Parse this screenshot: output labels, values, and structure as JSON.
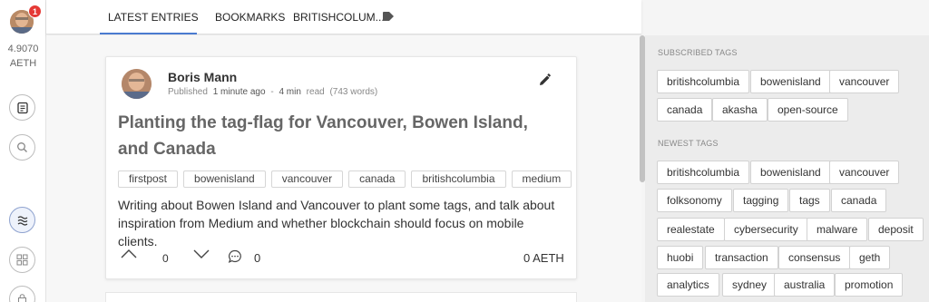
{
  "rail": {
    "notification_count": "1",
    "balance_value": "4.9070",
    "balance_unit": "AETH",
    "icons": [
      "drafts-icon",
      "search-icon",
      "stream-icon",
      "apps-icon",
      "lock-icon"
    ]
  },
  "tabs": {
    "latest": "LATEST ENTRIES",
    "bookmarks": "BOOKMARKS",
    "tag": "BRITISHCOLUM..."
  },
  "entry": {
    "author": "Boris Mann",
    "published_label": "Published",
    "published_time": "1 minute ago",
    "separator": "-",
    "read_time": "4 min",
    "read_label": "read",
    "word_count": "(743 words)",
    "title": "Planting the tag-flag for Vancouver, Bowen Island, and Canada",
    "tags": [
      "firstpost",
      "bowenisland",
      "vancouver",
      "canada",
      "britishcolumbia",
      "medium"
    ],
    "excerpt": "Writing about Bowen Island and Vancouver to plant some tags, and talk about inspiration from Medium and whether blockchain should focus on mobile clients.",
    "score": "0",
    "comments": "0",
    "balance": "0 AETH"
  },
  "sidebar": {
    "subscribed_title": "SUBSCRIBED TAGS",
    "subscribed": [
      "britishcolumbia",
      "bowenisland",
      "vancouver",
      "canada",
      "akasha",
      "open-source"
    ],
    "newest_title": "NEWEST TAGS",
    "newest": [
      "britishcolumbia",
      "bowenisland",
      "vancouver",
      "folksonomy",
      "tagging",
      "tags",
      "canada",
      "realestate",
      "cybersecurity",
      "malware",
      "deposit",
      "huobi",
      "transaction",
      "consensus",
      "geth",
      "analytics",
      "sydney",
      "australia",
      "promotion"
    ]
  },
  "colors": {
    "accent": "#4a7bd0",
    "badge": "#e53935"
  }
}
